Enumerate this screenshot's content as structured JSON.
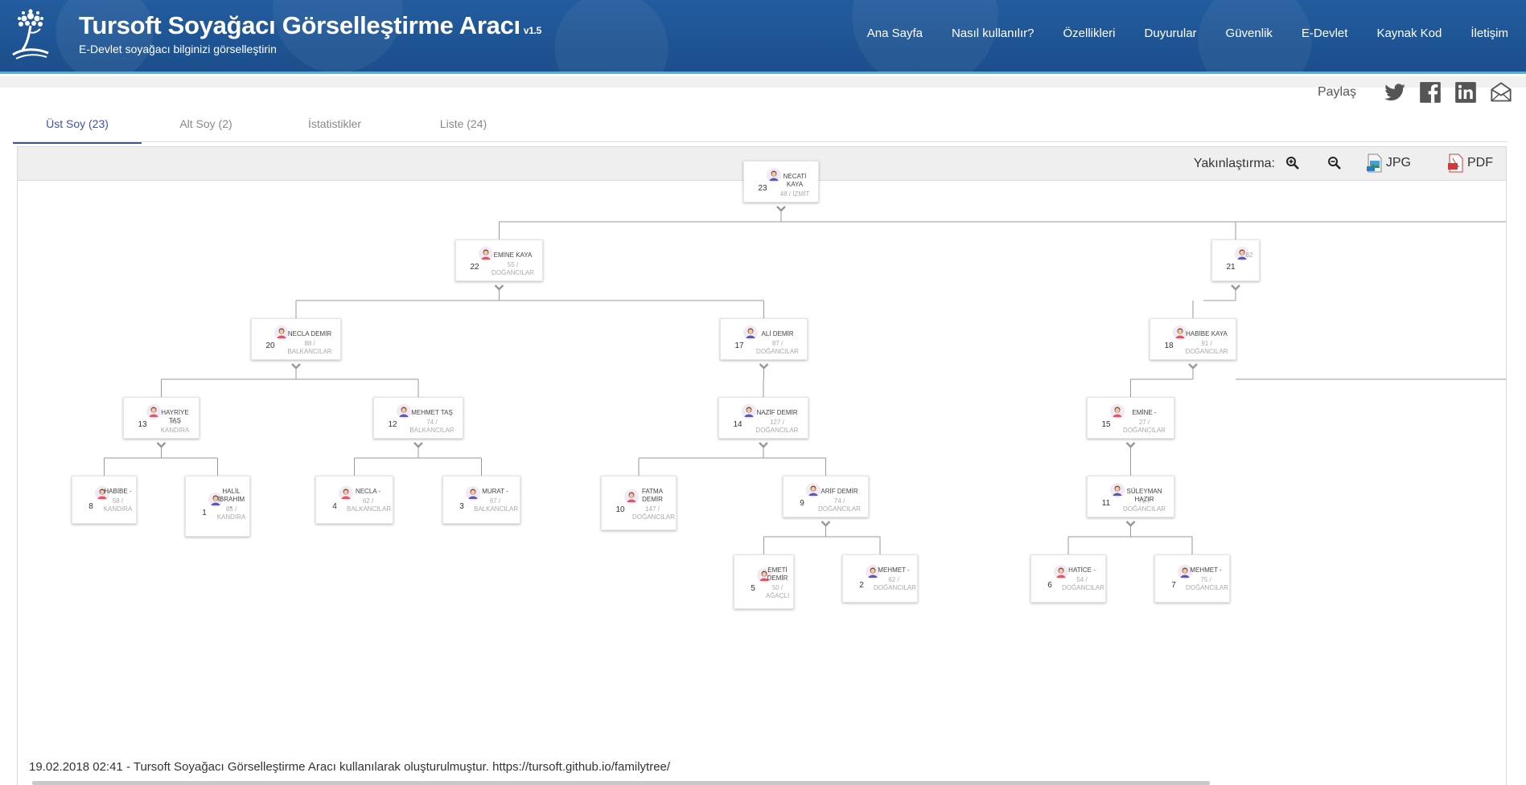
{
  "header": {
    "title": "Tursoft Soyağacı Görselleştirme Aracı",
    "version": "v1.5",
    "subtitle": "E-Devlet soyağacı bilginizi görselleştirin",
    "logo_icon": "tree-logo-icon",
    "nav": [
      "Ana Sayfa",
      "Nasıl kullanılır?",
      "Özellikleri",
      "Duyurular",
      "Güvenlik",
      "E-Devlet",
      "Kaynak Kod",
      "İletişim"
    ]
  },
  "share": {
    "label": "Paylaş",
    "icons": [
      "twitter-icon",
      "facebook-icon",
      "linkedin-icon",
      "email-icon"
    ]
  },
  "tabs": [
    "Üst Soy (23)",
    "Alt Soy (2)",
    "İstatistikler",
    "Liste (24)"
  ],
  "active_tab": 0,
  "toolbar": {
    "zoom_label": "Yakınlaştırma:",
    "zoom_in_icon": "zoom-in-icon",
    "zoom_out_icon": "zoom-out-icon",
    "jpg_label": "JPG",
    "pdf_label": "PDF"
  },
  "colors": {
    "header_bg": "#1f5797",
    "header_border": "#46b7d8",
    "active_tab": "#3f51b5",
    "female_avatar": "#e05562",
    "male_avatar": "#5b57b5"
  },
  "tree": {
    "nodes": [
      {
        "id": 23,
        "name": "NECATİ KAYA",
        "info": "48 / İZMİT",
        "gender": "male"
      },
      {
        "id": 22,
        "name": "EMİNE KAYA",
        "info": "55 / DOĞANCILAR",
        "gender": "female"
      },
      {
        "id": 21,
        "name": "",
        "info": "62",
        "gender": "male"
      },
      {
        "id": 20,
        "name": "NECLA DEMİR",
        "info": "88 / BALKANCILAR",
        "gender": "female"
      },
      {
        "id": 17,
        "name": "ALİ DEMİR",
        "info": "87 / DOĞANCILAR",
        "gender": "male"
      },
      {
        "id": 18,
        "name": "HABİBE KAYA",
        "info": "91 / DOĞANCILAR",
        "gender": "female"
      },
      {
        "id": 13,
        "name": "HAYRİYE TAŞ",
        "info": "74 / KANDIRA",
        "gender": "female"
      },
      {
        "id": 12,
        "name": "MEHMET TAŞ",
        "info": "74 / BALKANCILAR",
        "gender": "male"
      },
      {
        "id": 14,
        "name": "NAZİF DEMİR",
        "info": "127 / DOĞANCILAR",
        "gender": "male"
      },
      {
        "id": 15,
        "name": "EMİNE -",
        "info": "27 / DOĞANCILAR",
        "gender": "female"
      },
      {
        "id": 8,
        "name": "HABİBE -",
        "info": "58 / KANDIRA",
        "gender": "female"
      },
      {
        "id": 1,
        "name": "HALİL İBRAHİM -",
        "info": "85 / KANDIRA",
        "gender": "male"
      },
      {
        "id": 4,
        "name": "NECLA -",
        "info": "62 / BALKANCILAR",
        "gender": "female"
      },
      {
        "id": 3,
        "name": "MURAT -",
        "info": "67 / BALKANCILAR",
        "gender": "male"
      },
      {
        "id": 10,
        "name": "FATMA DEMİR",
        "info": "147 / DOĞANCILAR",
        "gender": "female"
      },
      {
        "id": 9,
        "name": "ARİF DEMİR",
        "info": "74 / DOĞANCILAR",
        "gender": "male"
      },
      {
        "id": 11,
        "name": "SÜLEYMAN HAZIR",
        "info": "72 / DOĞANCILAR",
        "gender": "male"
      },
      {
        "id": 5,
        "name": "EMETİ DEMİR",
        "info": "50 / AĞAÇLI",
        "gender": "female"
      },
      {
        "id": 2,
        "name": "MEHMET -",
        "info": "62 / DOĞANCILAR",
        "gender": "male"
      },
      {
        "id": 6,
        "name": "HATİCE -",
        "info": "54 / DOĞANCILAR",
        "gender": "female"
      },
      {
        "id": 7,
        "name": "MEHMET -",
        "info": "75 / DOĞANCILAR",
        "gender": "male"
      }
    ]
  },
  "footer_note": "19.02.2018 02:41 - Tursoft Soyağacı Görselleştirme Aracı kullanılarak oluşturulmuştur. https://tursoft.github.io/familytree/"
}
